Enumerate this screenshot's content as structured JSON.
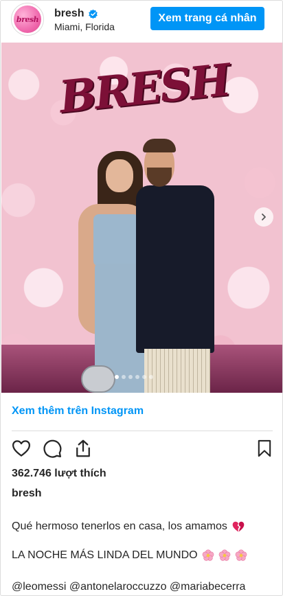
{
  "header": {
    "avatar_text": "bresh",
    "username": "bresh",
    "location": "Miami, Florida",
    "profile_button": "Xem trang cá nhân"
  },
  "photo": {
    "sign_text": "BRESH",
    "carousel": {
      "total": 6,
      "active_index": 0
    }
  },
  "links": {
    "view_more": "Xem thêm trên Instagram"
  },
  "post": {
    "likes": "362.746 lượt thích",
    "caption_user": "bresh",
    "caption_line1": "Qué hermoso tenerlos en casa, los amamos",
    "caption_line2": "LA NOCHE MÁS LINDA DEL MUNDO",
    "caption_line3": "@leomessi @antonelaroccuzzo @mariabecerra"
  },
  "icons": [
    "verified-icon",
    "next-icon",
    "heart-icon",
    "comment-icon",
    "share-icon",
    "bookmark-icon",
    "broken-heart-icon",
    "flower-icon"
  ],
  "colors": {
    "accent": "#0095f6",
    "text": "#262626",
    "border": "#dbdbdb"
  }
}
